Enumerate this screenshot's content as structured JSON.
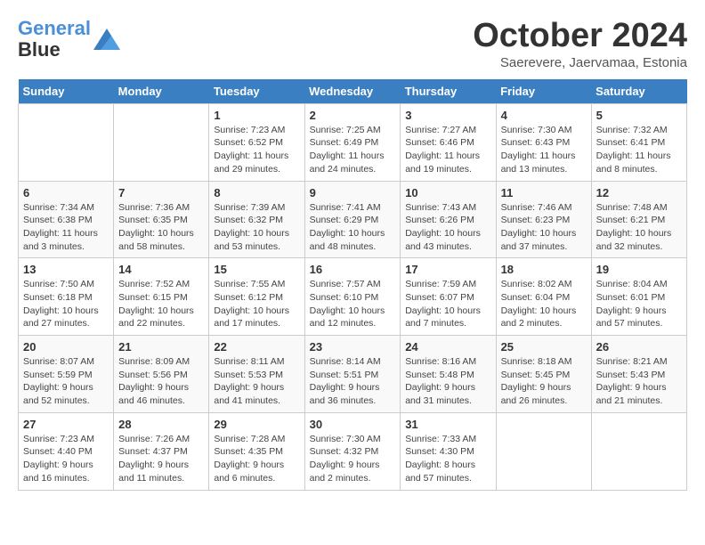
{
  "logo": {
    "line1": "General",
    "line2": "Blue"
  },
  "title": "October 2024",
  "subtitle": "Saerevere, Jaervamaa, Estonia",
  "days_header": [
    "Sunday",
    "Monday",
    "Tuesday",
    "Wednesday",
    "Thursday",
    "Friday",
    "Saturday"
  ],
  "weeks": [
    [
      {
        "day": "",
        "detail": ""
      },
      {
        "day": "",
        "detail": ""
      },
      {
        "day": "1",
        "detail": "Sunrise: 7:23 AM\nSunset: 6:52 PM\nDaylight: 11 hours and 29 minutes."
      },
      {
        "day": "2",
        "detail": "Sunrise: 7:25 AM\nSunset: 6:49 PM\nDaylight: 11 hours and 24 minutes."
      },
      {
        "day": "3",
        "detail": "Sunrise: 7:27 AM\nSunset: 6:46 PM\nDaylight: 11 hours and 19 minutes."
      },
      {
        "day": "4",
        "detail": "Sunrise: 7:30 AM\nSunset: 6:43 PM\nDaylight: 11 hours and 13 minutes."
      },
      {
        "day": "5",
        "detail": "Sunrise: 7:32 AM\nSunset: 6:41 PM\nDaylight: 11 hours and 8 minutes."
      }
    ],
    [
      {
        "day": "6",
        "detail": "Sunrise: 7:34 AM\nSunset: 6:38 PM\nDaylight: 11 hours and 3 minutes."
      },
      {
        "day": "7",
        "detail": "Sunrise: 7:36 AM\nSunset: 6:35 PM\nDaylight: 10 hours and 58 minutes."
      },
      {
        "day": "8",
        "detail": "Sunrise: 7:39 AM\nSunset: 6:32 PM\nDaylight: 10 hours and 53 minutes."
      },
      {
        "day": "9",
        "detail": "Sunrise: 7:41 AM\nSunset: 6:29 PM\nDaylight: 10 hours and 48 minutes."
      },
      {
        "day": "10",
        "detail": "Sunrise: 7:43 AM\nSunset: 6:26 PM\nDaylight: 10 hours and 43 minutes."
      },
      {
        "day": "11",
        "detail": "Sunrise: 7:46 AM\nSunset: 6:23 PM\nDaylight: 10 hours and 37 minutes."
      },
      {
        "day": "12",
        "detail": "Sunrise: 7:48 AM\nSunset: 6:21 PM\nDaylight: 10 hours and 32 minutes."
      }
    ],
    [
      {
        "day": "13",
        "detail": "Sunrise: 7:50 AM\nSunset: 6:18 PM\nDaylight: 10 hours and 27 minutes."
      },
      {
        "day": "14",
        "detail": "Sunrise: 7:52 AM\nSunset: 6:15 PM\nDaylight: 10 hours and 22 minutes."
      },
      {
        "day": "15",
        "detail": "Sunrise: 7:55 AM\nSunset: 6:12 PM\nDaylight: 10 hours and 17 minutes."
      },
      {
        "day": "16",
        "detail": "Sunrise: 7:57 AM\nSunset: 6:10 PM\nDaylight: 10 hours and 12 minutes."
      },
      {
        "day": "17",
        "detail": "Sunrise: 7:59 AM\nSunset: 6:07 PM\nDaylight: 10 hours and 7 minutes."
      },
      {
        "day": "18",
        "detail": "Sunrise: 8:02 AM\nSunset: 6:04 PM\nDaylight: 10 hours and 2 minutes."
      },
      {
        "day": "19",
        "detail": "Sunrise: 8:04 AM\nSunset: 6:01 PM\nDaylight: 9 hours and 57 minutes."
      }
    ],
    [
      {
        "day": "20",
        "detail": "Sunrise: 8:07 AM\nSunset: 5:59 PM\nDaylight: 9 hours and 52 minutes."
      },
      {
        "day": "21",
        "detail": "Sunrise: 8:09 AM\nSunset: 5:56 PM\nDaylight: 9 hours and 46 minutes."
      },
      {
        "day": "22",
        "detail": "Sunrise: 8:11 AM\nSunset: 5:53 PM\nDaylight: 9 hours and 41 minutes."
      },
      {
        "day": "23",
        "detail": "Sunrise: 8:14 AM\nSunset: 5:51 PM\nDaylight: 9 hours and 36 minutes."
      },
      {
        "day": "24",
        "detail": "Sunrise: 8:16 AM\nSunset: 5:48 PM\nDaylight: 9 hours and 31 minutes."
      },
      {
        "day": "25",
        "detail": "Sunrise: 8:18 AM\nSunset: 5:45 PM\nDaylight: 9 hours and 26 minutes."
      },
      {
        "day": "26",
        "detail": "Sunrise: 8:21 AM\nSunset: 5:43 PM\nDaylight: 9 hours and 21 minutes."
      }
    ],
    [
      {
        "day": "27",
        "detail": "Sunrise: 7:23 AM\nSunset: 4:40 PM\nDaylight: 9 hours and 16 minutes."
      },
      {
        "day": "28",
        "detail": "Sunrise: 7:26 AM\nSunset: 4:37 PM\nDaylight: 9 hours and 11 minutes."
      },
      {
        "day": "29",
        "detail": "Sunrise: 7:28 AM\nSunset: 4:35 PM\nDaylight: 9 hours and 6 minutes."
      },
      {
        "day": "30",
        "detail": "Sunrise: 7:30 AM\nSunset: 4:32 PM\nDaylight: 9 hours and 2 minutes."
      },
      {
        "day": "31",
        "detail": "Sunrise: 7:33 AM\nSunset: 4:30 PM\nDaylight: 8 hours and 57 minutes."
      },
      {
        "day": "",
        "detail": ""
      },
      {
        "day": "",
        "detail": ""
      }
    ]
  ]
}
